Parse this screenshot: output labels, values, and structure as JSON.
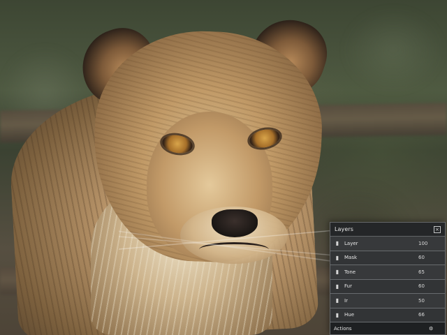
{
  "photo": {
    "subject": "lion"
  },
  "panel": {
    "title": "Layers",
    "close_icon": "close-icon",
    "rows": [
      {
        "name": "Layer",
        "value": "100",
        "icon": "layer-icon"
      },
      {
        "name": "Mask",
        "value": "60",
        "icon": "layer-icon"
      },
      {
        "name": "Tone",
        "value": "65",
        "icon": "layer-icon"
      },
      {
        "name": "Fur",
        "value": "60",
        "icon": "layer-icon"
      },
      {
        "name": "Ir",
        "value": "50",
        "icon": "layer-icon"
      },
      {
        "name": "Hue",
        "value": "66",
        "icon": "layer-icon"
      }
    ],
    "footer_label": "Actions"
  }
}
